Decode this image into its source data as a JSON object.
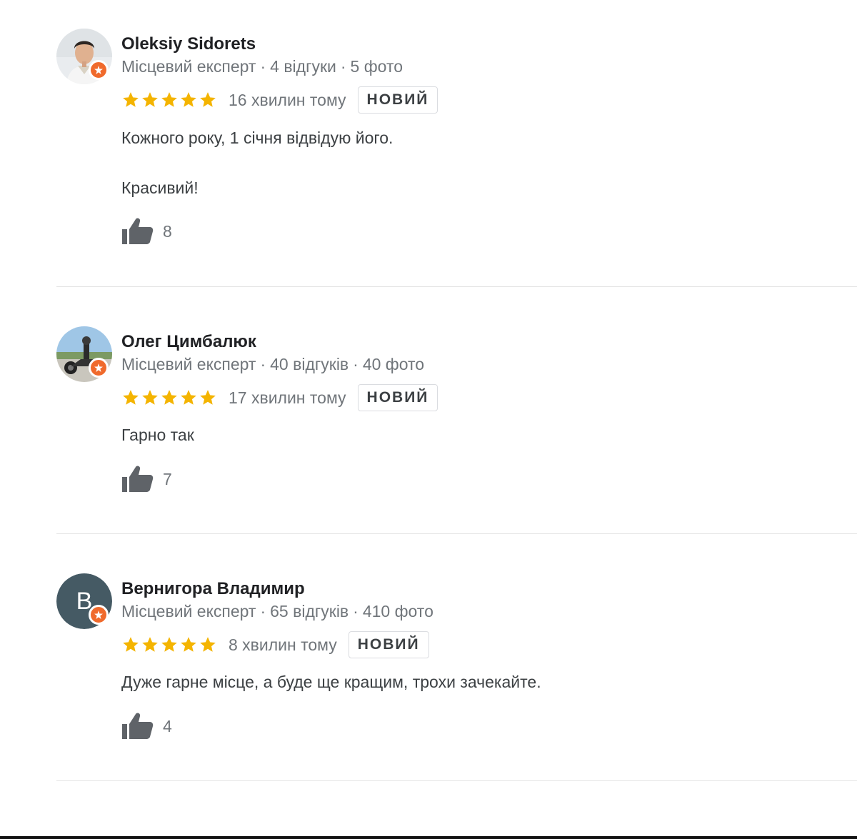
{
  "colors": {
    "star": "#f4b400",
    "badge": "#f06a2c",
    "avatar_letter_bg": "#455a64",
    "divider": "#e3e3e3"
  },
  "reviews": [
    {
      "author": "Oleksiy Sidorets",
      "role": "Місцевий експерт",
      "reviews_count": "4 відгуки",
      "photos_count": "5 фото",
      "rating": 5,
      "time": "16 хвилин тому",
      "badge": "НОВИЙ",
      "text_lines": [
        "Кожного року, 1 січня відвідую його.",
        "Красивий!"
      ],
      "likes": "8",
      "avatar": "photo-man-icon"
    },
    {
      "author": "Олег Цимбалюк",
      "role": "Місцевий експерт",
      "reviews_count": "40 відгуків",
      "photos_count": "40 фото",
      "rating": 5,
      "time": "17 хвилин тому",
      "badge": "НОВИЙ",
      "text_lines": [
        "Гарно так"
      ],
      "likes": "7",
      "avatar": "photo-motorcycle-icon"
    },
    {
      "author": "Вернигора Владимир",
      "role": "Місцевий експерт",
      "reviews_count": "65 відгуків",
      "photos_count": "410 фото",
      "rating": 5,
      "time": "8 хвилин тому",
      "badge": "НОВИЙ",
      "text_lines": [
        "Дуже гарне місце, а буде ще кращим, трохи зачекайте."
      ],
      "likes": "4",
      "avatar_letter": "В"
    }
  ]
}
